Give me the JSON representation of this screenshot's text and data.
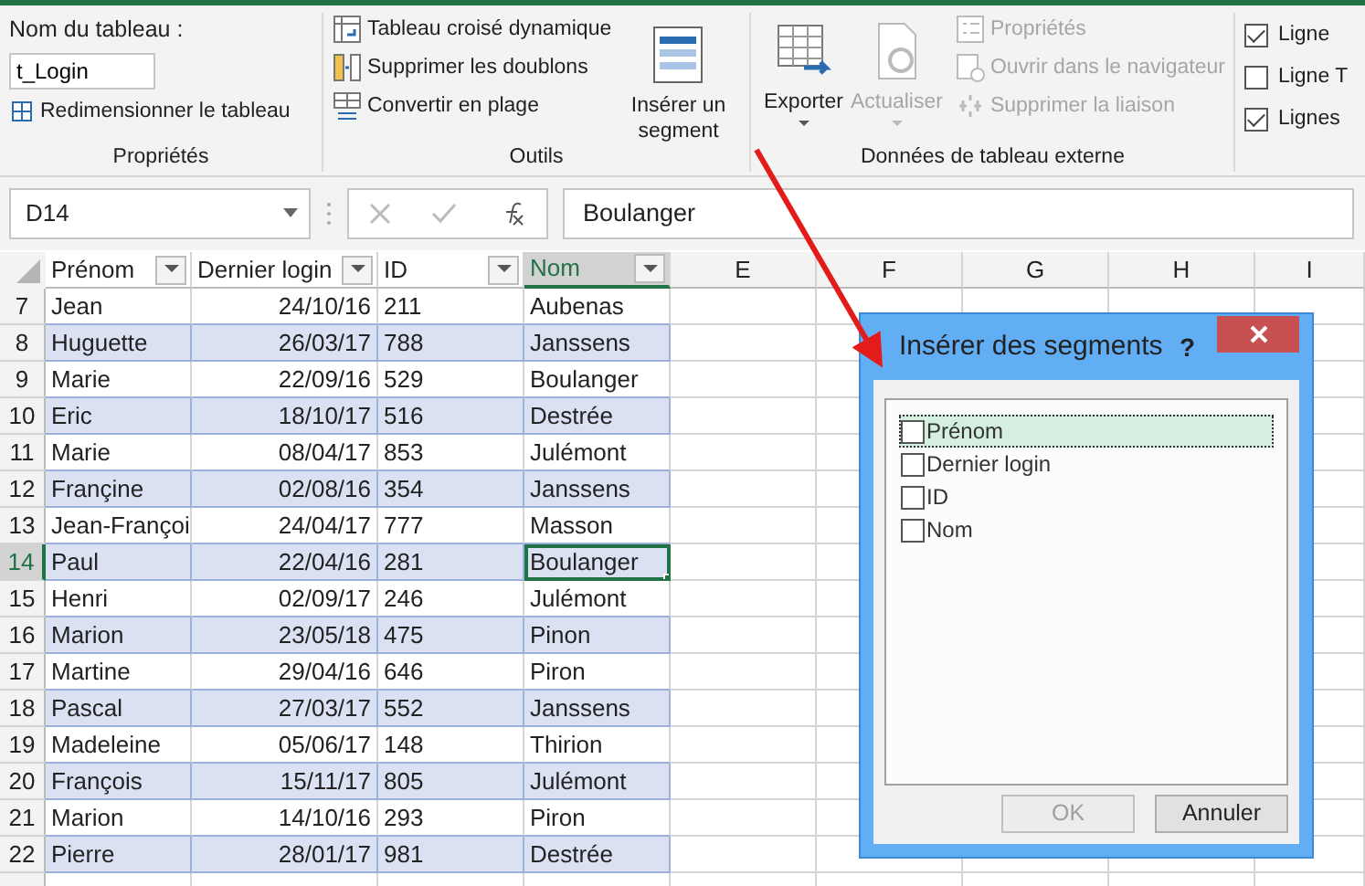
{
  "ribbon": {
    "groups": [
      {
        "label": "Propriétés",
        "kind": "name",
        "field_label": "Nom du tableau :",
        "field_value": "t_Login",
        "button": "Redimensionner le tableau"
      },
      {
        "label": "Outils",
        "kind": "tools",
        "items": [
          {
            "label": "Tableau croisé dynamique",
            "disabled": false
          },
          {
            "label": "Supprimer les doublons",
            "disabled": false
          },
          {
            "label": "Convertir en plage",
            "disabled": false
          }
        ],
        "large": [
          {
            "label": "Insérer un segment",
            "disabled": false
          }
        ]
      },
      {
        "label": "Données de tableau externe",
        "kind": "external",
        "large": [
          {
            "label": "Exporter",
            "disabled": false,
            "dropdown": true
          },
          {
            "label": "Actualiser",
            "disabled": true,
            "dropdown": true
          }
        ],
        "items": [
          {
            "label": "Propriétés",
            "disabled": true
          },
          {
            "label": "Ouvrir dans le navigateur",
            "disabled": true
          },
          {
            "label": "Supprimer la liaison",
            "disabled": true
          }
        ]
      },
      {
        "kind": "options",
        "checks": [
          {
            "label": "Ligne",
            "checked": true
          },
          {
            "label": "Ligne T",
            "checked": false
          },
          {
            "label": "Lignes",
            "checked": true
          }
        ]
      }
    ]
  },
  "formula_bar": {
    "name_box": "D14",
    "value": "Boulanger"
  },
  "sheet": {
    "columns": [
      {
        "label": "Prénom",
        "filter": true,
        "selected": false
      },
      {
        "label": "Dernier login",
        "filter": true,
        "selected": false
      },
      {
        "label": "ID",
        "filter": true,
        "selected": false
      },
      {
        "label": "Nom",
        "filter": true,
        "selected": true
      },
      {
        "label": "E",
        "filter": false,
        "selected": false
      },
      {
        "label": "F",
        "filter": false,
        "selected": false
      },
      {
        "label": "G",
        "filter": false,
        "selected": false
      },
      {
        "label": "H",
        "filter": false,
        "selected": false
      },
      {
        "label": "I",
        "filter": false,
        "selected": false
      }
    ],
    "rows": [
      {
        "number": "7",
        "selected": false,
        "cells": [
          "Jean",
          "24/10/16",
          "211",
          "Aubenas"
        ]
      },
      {
        "number": "8",
        "selected": false,
        "cells": [
          "Huguette",
          "26/03/17",
          "788",
          "Janssens"
        ]
      },
      {
        "number": "9",
        "selected": false,
        "cells": [
          "Marie",
          "22/09/16",
          "529",
          "Boulanger"
        ]
      },
      {
        "number": "10",
        "selected": false,
        "cells": [
          "Eric",
          "18/10/17",
          "516",
          "Destrée"
        ]
      },
      {
        "number": "11",
        "selected": false,
        "cells": [
          "Marie",
          "08/04/17",
          "853",
          "Julémont"
        ]
      },
      {
        "number": "12",
        "selected": false,
        "cells": [
          "Françine",
          "02/08/16",
          "354",
          "Janssens"
        ]
      },
      {
        "number": "13",
        "selected": false,
        "cells": [
          "Jean-Françoi",
          "24/04/17",
          "777",
          "Masson"
        ]
      },
      {
        "number": "14",
        "selected": true,
        "cells": [
          "Paul",
          "22/04/16",
          "281",
          "Boulanger"
        ]
      },
      {
        "number": "15",
        "selected": false,
        "cells": [
          "Henri",
          "02/09/17",
          "246",
          "Julémont"
        ]
      },
      {
        "number": "16",
        "selected": false,
        "cells": [
          "Marion",
          "23/05/18",
          "475",
          "Pinon"
        ]
      },
      {
        "number": "17",
        "selected": false,
        "cells": [
          "Martine",
          "29/04/16",
          "646",
          "Piron"
        ]
      },
      {
        "number": "18",
        "selected": false,
        "cells": [
          "Pascal",
          "27/03/17",
          "552",
          "Janssens"
        ]
      },
      {
        "number": "19",
        "selected": false,
        "cells": [
          "Madeleine",
          "05/06/17",
          "148",
          "Thirion"
        ]
      },
      {
        "number": "20",
        "selected": false,
        "cells": [
          "François",
          "15/11/17",
          "805",
          "Julémont"
        ]
      },
      {
        "number": "21",
        "selected": false,
        "cells": [
          "Marion",
          "14/10/16",
          "293",
          "Piron"
        ]
      },
      {
        "number": "22",
        "selected": false,
        "cells": [
          "Pierre",
          "28/01/17",
          "981",
          "Destrée"
        ]
      }
    ]
  },
  "dialog": {
    "title": "Insérer des segments",
    "help": "?",
    "items": [
      {
        "label": "Prénom",
        "checked": false,
        "selected": true
      },
      {
        "label": "Dernier login",
        "checked": false,
        "selected": false
      },
      {
        "label": "ID",
        "checked": false,
        "selected": false
      },
      {
        "label": "Nom",
        "checked": false,
        "selected": false
      }
    ],
    "buttons": [
      {
        "label": "OK",
        "disabled": true
      },
      {
        "label": "Annuler",
        "disabled": false
      }
    ]
  }
}
